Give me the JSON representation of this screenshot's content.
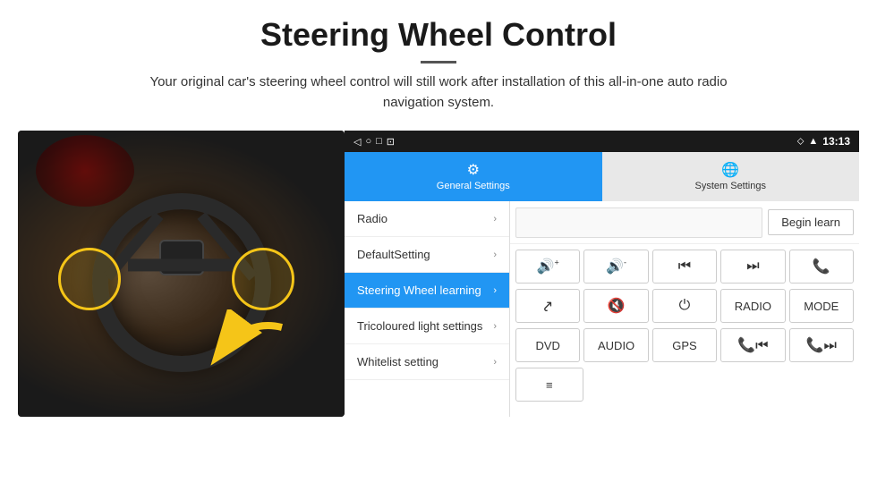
{
  "page": {
    "title": "Steering Wheel Control",
    "subtitle": "Your original car's steering wheel control will still work after installation of this all-in-one auto radio navigation system."
  },
  "status_bar": {
    "icons": "◁  ○  □  ⊡",
    "location_icon": "♦",
    "signal_icon": "▲",
    "time": "13:13"
  },
  "tabs": [
    {
      "id": "general",
      "label": "General Settings",
      "icon": "⚙",
      "active": true
    },
    {
      "id": "system",
      "label": "System Settings",
      "icon": "🌐",
      "active": false
    }
  ],
  "menu_items": [
    {
      "id": "radio",
      "label": "Radio",
      "active": false
    },
    {
      "id": "default",
      "label": "DefaultSetting",
      "active": false
    },
    {
      "id": "steering",
      "label": "Steering Wheel learning",
      "active": true
    },
    {
      "id": "tricoloured",
      "label": "Tricoloured light settings",
      "active": false
    },
    {
      "id": "whitelist",
      "label": "Whitelist setting",
      "active": false
    }
  ],
  "controls": {
    "begin_learn_label": "Begin learn",
    "empty_input_placeholder": "",
    "buttons_row1": [
      {
        "id": "vol_up",
        "label": "🔊+",
        "icon": true
      },
      {
        "id": "vol_down",
        "label": "🔊-",
        "icon": true
      },
      {
        "id": "prev_track",
        "label": "⏮",
        "icon": true
      },
      {
        "id": "next_track",
        "label": "⏭",
        "icon": true
      },
      {
        "id": "call",
        "label": "📞",
        "icon": true
      }
    ],
    "buttons_row2": [
      {
        "id": "hangup",
        "label": "↩",
        "icon": true
      },
      {
        "id": "mute",
        "label": "🔊✕",
        "icon": true
      },
      {
        "id": "power",
        "label": "⏻",
        "icon": true
      },
      {
        "id": "radio_btn",
        "label": "RADIO",
        "icon": false
      },
      {
        "id": "mode_btn",
        "label": "MODE",
        "icon": false
      }
    ],
    "buttons_row3": [
      {
        "id": "dvd",
        "label": "DVD",
        "icon": false
      },
      {
        "id": "audio",
        "label": "AUDIO",
        "icon": false
      },
      {
        "id": "gps",
        "label": "GPS",
        "icon": false
      },
      {
        "id": "prev_call",
        "label": "📞⏮",
        "icon": true
      },
      {
        "id": "next_call",
        "label": "📞⏭",
        "icon": true
      }
    ],
    "buttons_row4": [
      {
        "id": "music_list",
        "label": "≡",
        "icon": true
      }
    ]
  }
}
